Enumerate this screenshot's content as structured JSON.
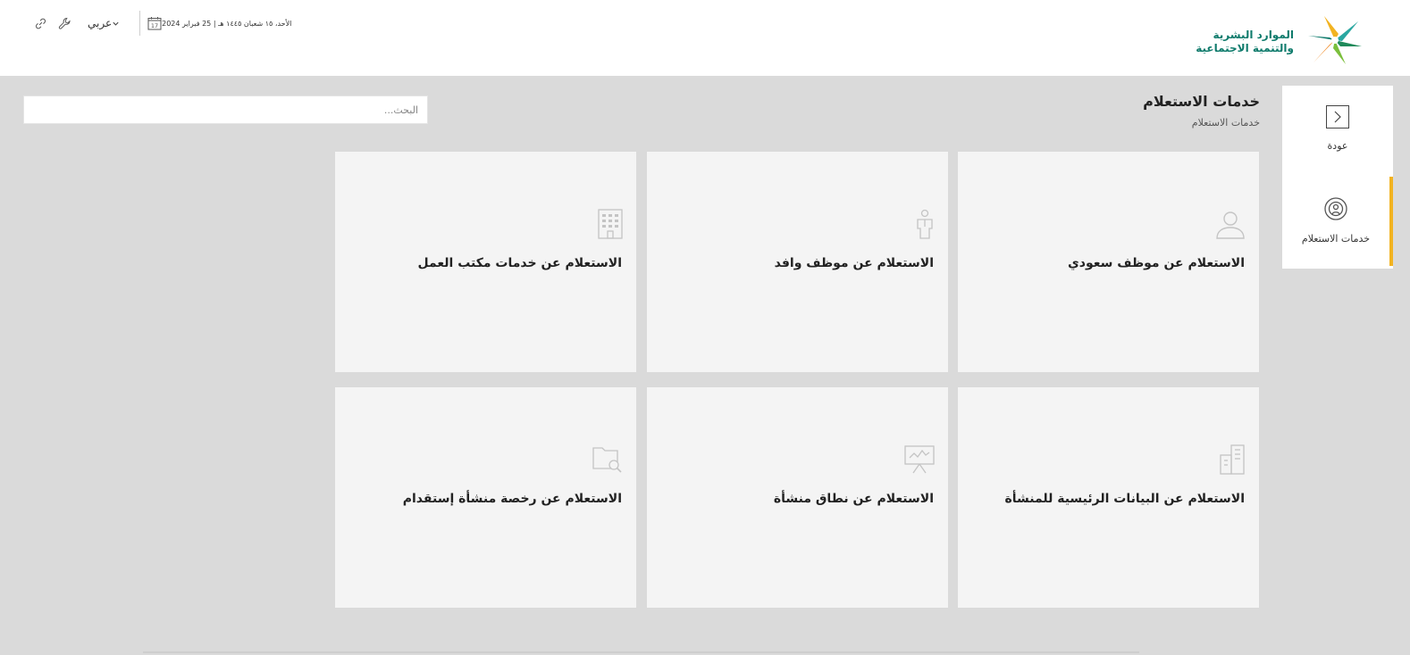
{
  "header": {
    "logo_line1": "الموارد البشرية",
    "logo_line2": "والتنمية الاجتماعية",
    "date_text": "الأحد، ١٥ شعبان ١٤٤٥ هـ | 25 فبراير 2024",
    "calendar_day": "17",
    "language": "عربي"
  },
  "sidebar": {
    "items": [
      {
        "label": "عودة",
        "icon": "chevron-right-icon"
      },
      {
        "label": "خدمات الاستعلام",
        "icon": "inquiry-signal-icon",
        "active": true
      }
    ],
    "accent_color": "#f2b321"
  },
  "page": {
    "title": "خدمات الاستعلام",
    "breadcrumb": "خدمات الاستعلام"
  },
  "search": {
    "placeholder": "البحث..."
  },
  "cards": [
    {
      "title": "الاستعلام عن موظف سعودي",
      "icon": "person-icon"
    },
    {
      "title": "الاستعلام عن موظف وافد",
      "icon": "worker-icon"
    },
    {
      "title": "الاستعلام عن خدمات مكتب العمل",
      "icon": "building-icon"
    },
    {
      "title": "الاستعلام عن البيانات الرئيسية للمنشأة",
      "icon": "office-buildings-icon"
    },
    {
      "title": "الاستعلام عن نطاق منشأة",
      "icon": "presentation-chart-icon"
    },
    {
      "title": "الاستعلام عن رخصة منشأة إستقدام",
      "icon": "folder-search-icon"
    }
  ],
  "colors": {
    "background": "#dadada",
    "card": "#f4f4f4",
    "brand_green": "#0f7b6c",
    "icon_gray": "#c4c4c4"
  }
}
